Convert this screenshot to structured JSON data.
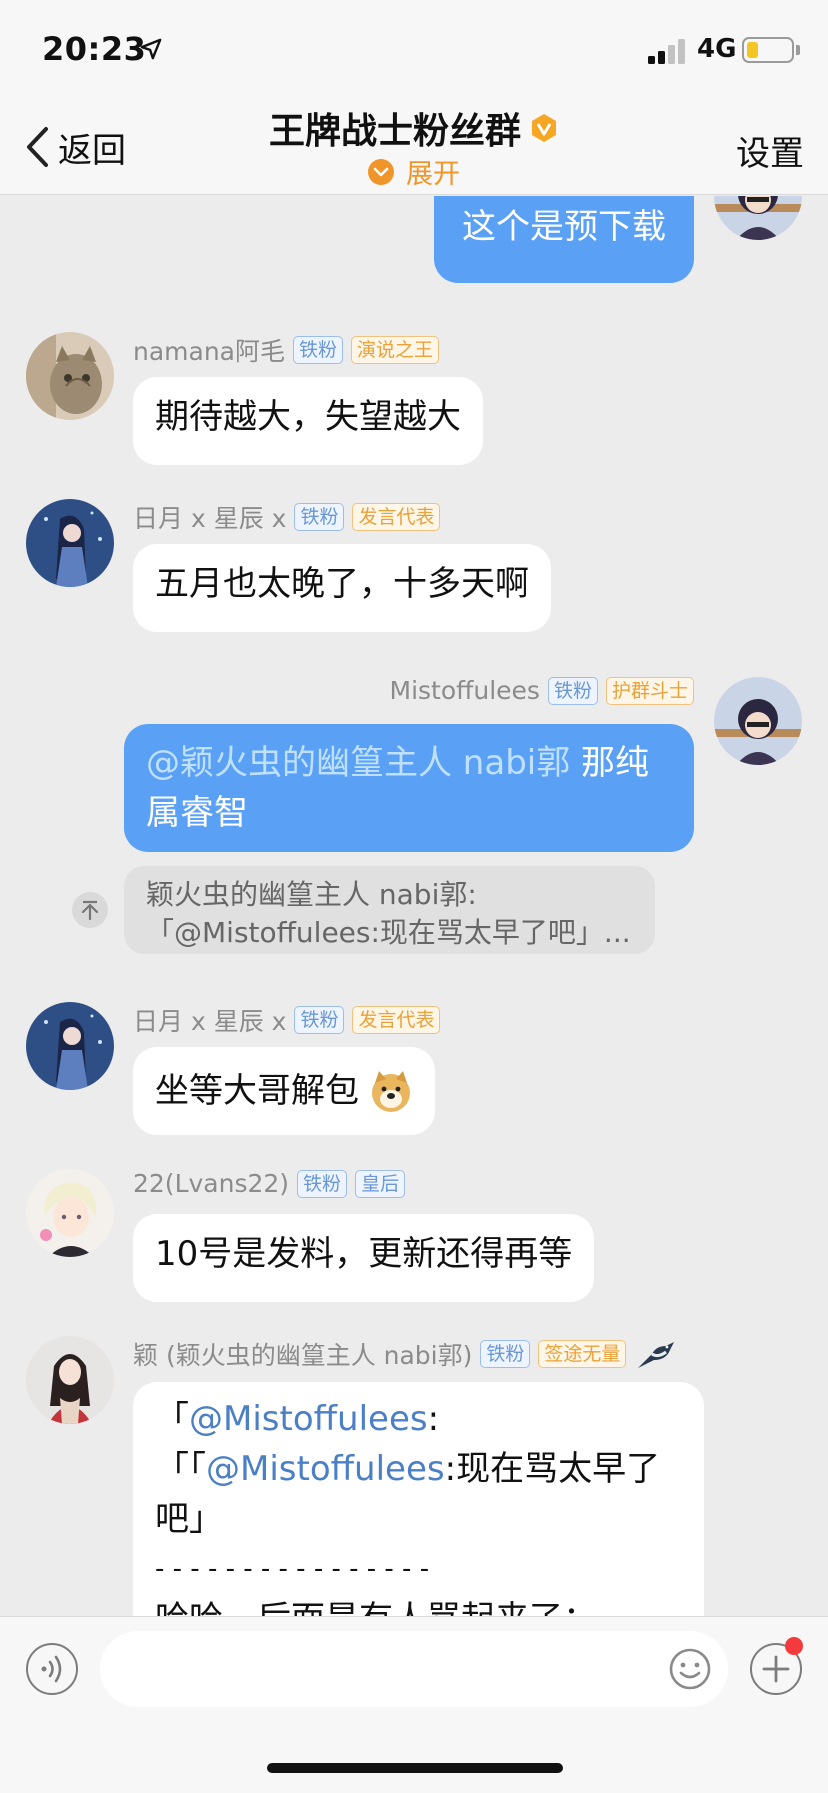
{
  "status_bar": {
    "time": "20:23",
    "network": "4G",
    "battery_level": 0.25
  },
  "nav": {
    "back_label": "返回",
    "title": "王牌战士粉丝群",
    "expand_label": "展开",
    "settings_label": "设置"
  },
  "messages": [
    {
      "id": "m0",
      "sender": "",
      "mine": true,
      "text": "这个是预下载"
    },
    {
      "id": "m1",
      "sender": "namana阿毛",
      "tags": [
        "铁粉",
        "演说之王"
      ],
      "text": "期待越大，失望越大"
    },
    {
      "id": "m2",
      "sender": "日月 x 星辰 x",
      "tags": [
        "铁粉",
        "发言代表"
      ],
      "text": "五月也太晚了，十多天啊"
    },
    {
      "id": "m3",
      "sender": "Mistoffulees",
      "mine": true,
      "tags": [
        "铁粉",
        "护群斗士"
      ],
      "mention": "@颖火虫的幽篁主人 nabi郭",
      "text_line1": " 那纯",
      "text_line2": "属睿智",
      "quote_line1": "颖火虫的幽篁主人 nabi郭:",
      "quote_line2": "「@Mistoffulees:现在骂太早了吧」..."
    },
    {
      "id": "m4",
      "sender": "日月 x 星辰 x",
      "tags": [
        "铁粉",
        "发言代表"
      ],
      "text": "坐等大哥解包"
    },
    {
      "id": "m5",
      "sender": "22(Lvans22)",
      "tags": [
        "铁粉",
        "皇后"
      ],
      "text": "10号是发料，更新还得再等"
    },
    {
      "id": "m6",
      "sender": "颖 (颖火虫的幽篁主人 nabi郭)",
      "tags": [
        "铁粉",
        "签途无量"
      ],
      "line1_prefix": "「",
      "line1_link": "@Mistoffulees",
      "line1_suffix": ":",
      "line2_prefix": "「「",
      "line2_link": "@Mistoffulees",
      "line2_suffix": ":现在骂太早了",
      "line3": "吧」",
      "line4": "- - - - - - - - - - - - - - - -",
      "line5": "哈哈，后面是有人骂起来了："
    }
  ],
  "input_bar": {
    "placeholder": ""
  },
  "colors": {
    "accent_blue": "#5aa1f5",
    "orange": "#f0952a",
    "background": "#ececec"
  }
}
